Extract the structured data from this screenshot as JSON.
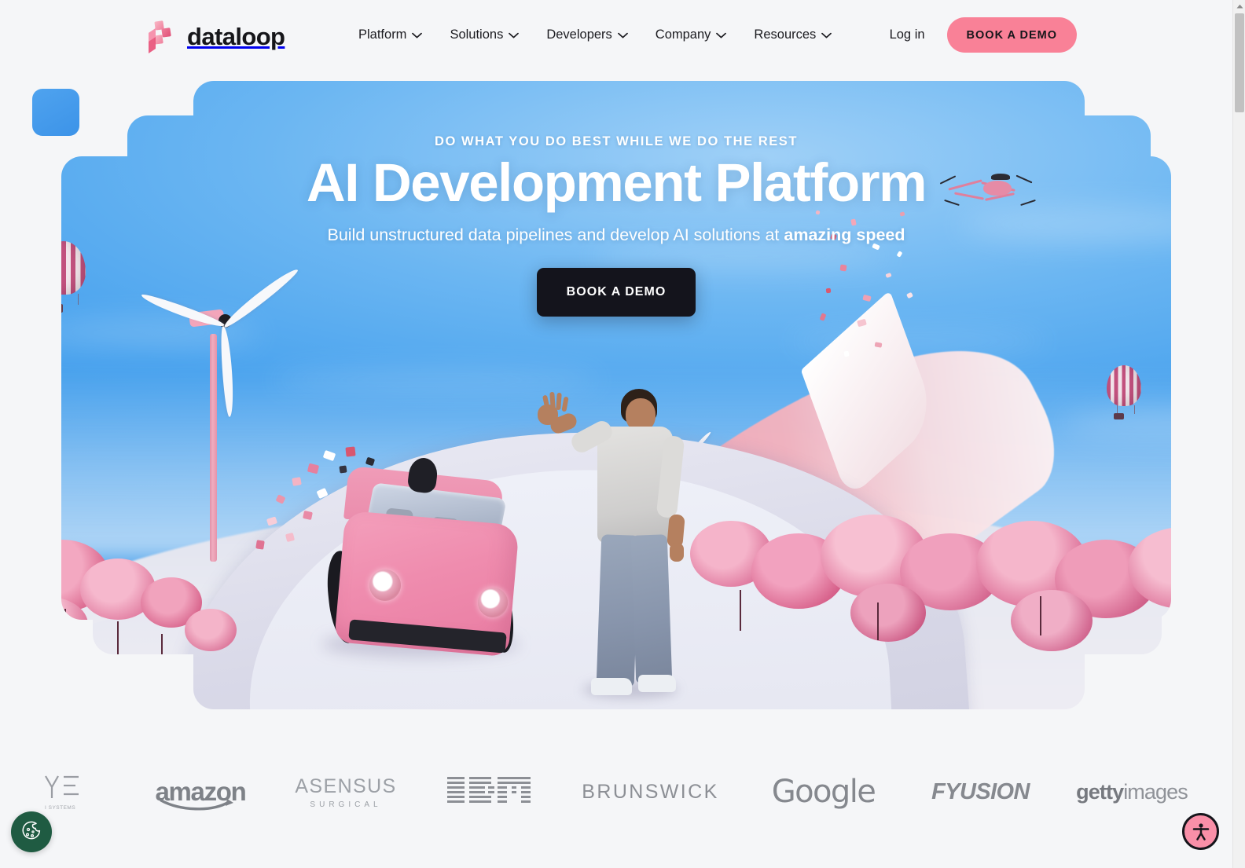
{
  "header": {
    "logo_text": "dataloop",
    "logo_icon": "dataloop-blocks-logo",
    "nav": [
      {
        "label": "Platform",
        "icon": "chevron-down-icon"
      },
      {
        "label": "Solutions",
        "icon": "chevron-down-icon"
      },
      {
        "label": "Developers",
        "icon": "chevron-down-icon"
      },
      {
        "label": "Company",
        "icon": "chevron-down-icon"
      },
      {
        "label": "Resources",
        "icon": "chevron-down-icon"
      }
    ],
    "login_label": "Log in",
    "demo_label": "BOOK A DEMO"
  },
  "hero": {
    "eyebrow": "DO WHAT YOU DO BEST WHILE WE DO THE REST",
    "title": "AI Development Platform",
    "subtitle_lead": "Build unstructured data pipelines and develop AI solutions at ",
    "subtitle_strong": "amazing speed",
    "cta_label": "BOOK A DEMO"
  },
  "logos": [
    {
      "name": "ye-systems",
      "text": "YΞ",
      "caption": "I SYSTEMS"
    },
    {
      "name": "amazon",
      "text": "amazon",
      "caption": ""
    },
    {
      "name": "asensus-surgical",
      "text": "ASENSUS",
      "caption": "SURGICAL"
    },
    {
      "name": "ibm",
      "text": "IBM",
      "caption": ""
    },
    {
      "name": "brunswick",
      "text": "BRUNSWICK",
      "caption": ""
    },
    {
      "name": "google",
      "text": "Google",
      "caption": ""
    },
    {
      "name": "fyusion",
      "text": "FYUSION",
      "caption": ""
    },
    {
      "name": "getty-images",
      "text": "getty",
      "caption": "images"
    },
    {
      "name": "partner-logo",
      "text": "",
      "caption": ""
    }
  ],
  "widgets": {
    "cookie_icon": "cookie-icon",
    "accessibility_icon": "accessibility-person-icon"
  },
  "colors": {
    "accent_pink": "#f98197",
    "hero_dark": "#14141c",
    "sky_blue": "#4aa3ee",
    "page_bg": "#f5f6f8",
    "cookie_green": "#1f5b42"
  }
}
